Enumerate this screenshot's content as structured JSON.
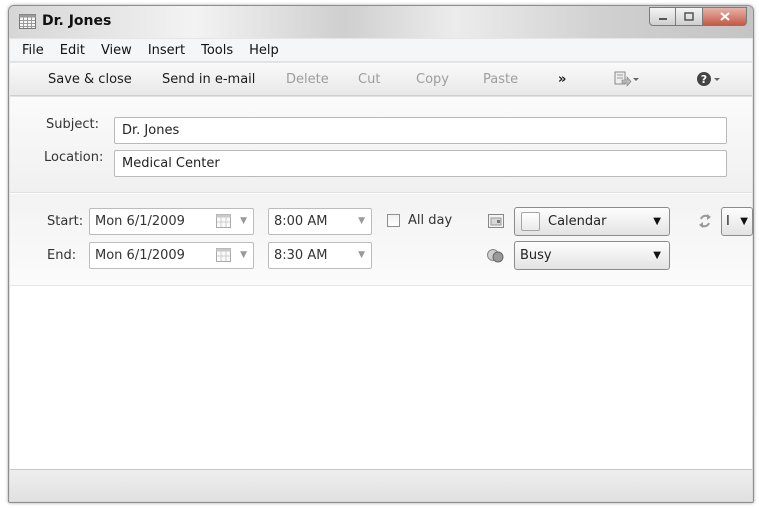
{
  "window": {
    "title": "Dr. Jones"
  },
  "menu": {
    "items": [
      "File",
      "Edit",
      "View",
      "Insert",
      "Tools",
      "Help"
    ]
  },
  "toolbar": {
    "save_close": "Save & close",
    "send_email": "Send in e-mail",
    "delete": "Delete",
    "cut": "Cut",
    "copy": "Copy",
    "paste": "Paste",
    "more": "»"
  },
  "event": {
    "subject_label": "Subject:",
    "subject_value": "Dr. Jones",
    "location_label": "Location:",
    "location_value": "Medical Center"
  },
  "time": {
    "start_label": "Start:",
    "start_date": "Mon 6/1/2009",
    "start_time": "8:00 AM",
    "end_label": "End:",
    "end_date": "Mon 6/1/2009",
    "end_time": "8:30 AM",
    "all_day_label": "All day",
    "all_day_checked": false
  },
  "options": {
    "calendar_value": "Calendar",
    "status_value": "Busy",
    "repeat_value": "I"
  },
  "icons": {
    "app": "calendar-grid-icon",
    "minimize": "minimize-icon",
    "maximize": "maximize-icon",
    "close": "close-icon",
    "publish": "publish-icon",
    "help": "help-icon",
    "calendar_picker": "calendar-picker-icon",
    "calendar_select": "calendar-select-icon",
    "status": "status-icon",
    "repeat": "repeat-icon"
  },
  "colors": {
    "close_button": "#c45a46",
    "help_icon": "#333333"
  }
}
